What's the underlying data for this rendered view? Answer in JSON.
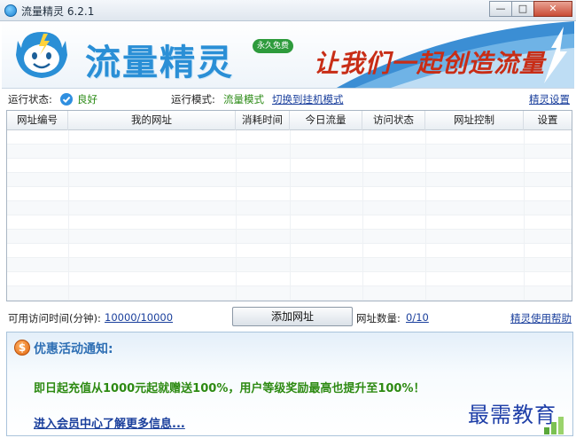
{
  "window": {
    "title": "流量精灵 6.2.1",
    "minimize_glyph": "—",
    "maximize_glyph": "□",
    "close_glyph": "✕"
  },
  "banner": {
    "brand": "流量精灵",
    "badge": "永久免费",
    "slogan": "让我们一起创造流量",
    "brand_color": "#2a8fd6",
    "slogan_color": "#c82d16"
  },
  "status": {
    "run_status_label": "运行状态:",
    "run_status_icon": "check-circle-icon",
    "run_status_value": "良好",
    "mode_label": "运行模式:",
    "mode_value": "流量模式",
    "switch_mode_link": "切换到挂机模式",
    "settings_link": "精灵设置"
  },
  "table": {
    "columns": [
      "网址编号",
      "我的网址",
      "消耗时间",
      "今日流量",
      "访问状态",
      "网址控制",
      "设置"
    ],
    "rows": []
  },
  "bottom": {
    "available_time_label": "可用访问时间(分钟):",
    "available_time_value": "10000/10000",
    "add_button": "添加网址",
    "url_count_label": "网址数量:",
    "url_count_value": "0/10",
    "help_link": "精灵使用帮助"
  },
  "notice": {
    "icon_glyph": "$",
    "title": "优惠活动通知:",
    "text": "即日起充值从1000元起就赠送100%，用户等级奖励最高也提升至100%！",
    "link": "进入会员中心了解更多信息..."
  },
  "watermark": "最需教育"
}
